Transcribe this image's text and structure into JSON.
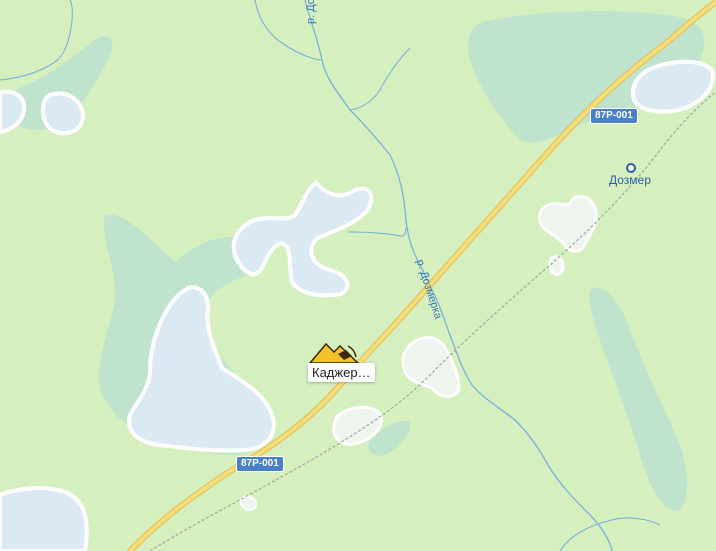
{
  "map": {
    "colors": {
      "land": "#d5efbf",
      "forest": "#bfe3cc",
      "water": "#dbe9f3",
      "water_edge": "#ffffff",
      "river": "#7ab2d8",
      "road": "#f2d36b",
      "road_edge": "#e0bd52",
      "railway": "#a9a9a9"
    },
    "road_shields": [
      {
        "id": "north",
        "label": "87Р-001"
      },
      {
        "id": "south",
        "label": "87Р-001"
      }
    ],
    "rivers": [
      {
        "id": "dozmerka-north",
        "label": "р. Дозм"
      },
      {
        "id": "dozmerka-central",
        "label": "р. Дозмерка"
      }
    ],
    "places": [
      {
        "id": "dozmer",
        "label": "Дозмер"
      }
    ],
    "poi": {
      "label": "Каджер…",
      "icon": "quarry-icon",
      "icon_color": "#f3c22c"
    }
  }
}
